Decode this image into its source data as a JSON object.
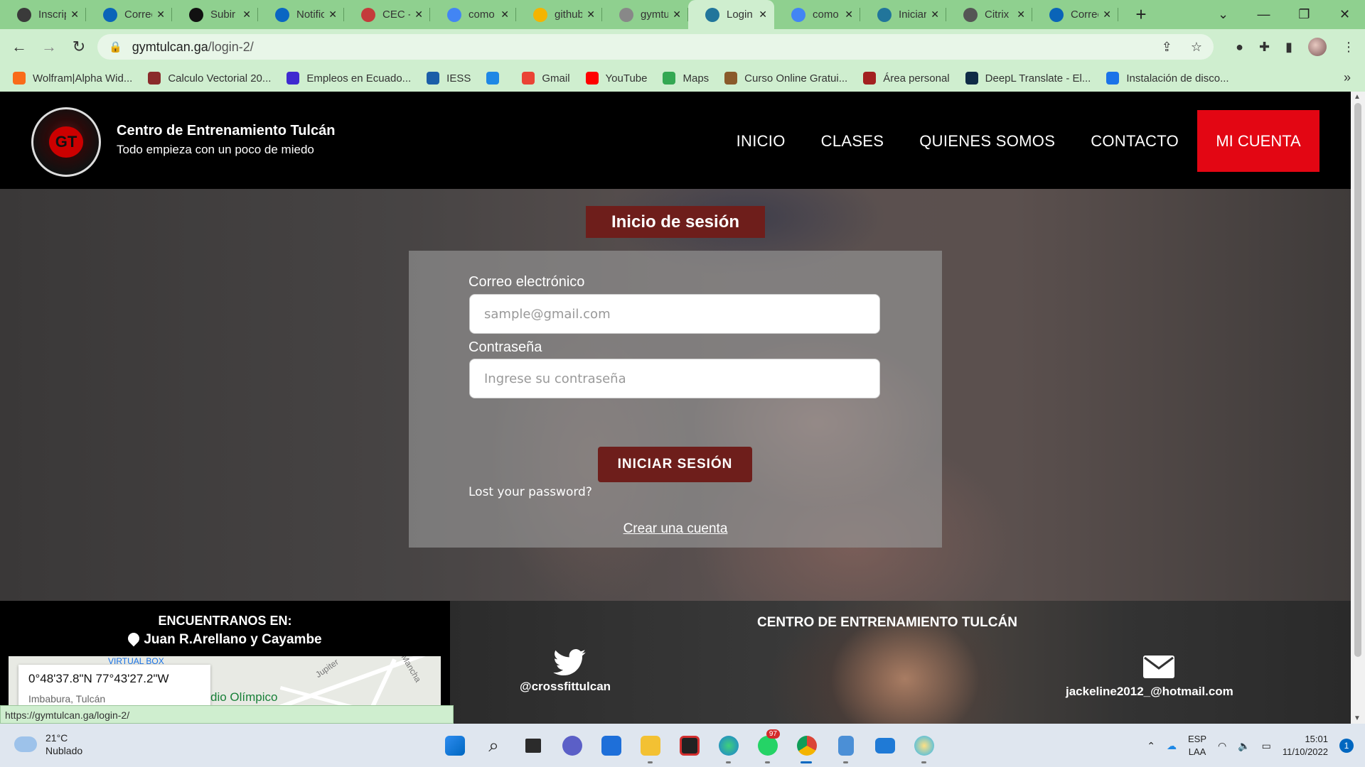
{
  "browser": {
    "tabs": [
      {
        "label": "Inscrip",
        "favicon_color": "#3a3a3a"
      },
      {
        "label": "Correo",
        "favicon_color": "#0a64b8"
      },
      {
        "label": "Subir",
        "favicon_color": "#111111"
      },
      {
        "label": "Notific",
        "favicon_color": "#0a66c2"
      },
      {
        "label": "CEC -",
        "favicon_color": "#c43b3b"
      },
      {
        "label": "como",
        "favicon_color": "#4285f4"
      },
      {
        "label": "github",
        "favicon_color": "#f4b400"
      },
      {
        "label": "gymtu",
        "favicon_color": "#888888"
      },
      {
        "label": "Login",
        "favicon_color": "#21759b",
        "active": true
      },
      {
        "label": "como",
        "favicon_color": "#4285f4"
      },
      {
        "label": "Iniciar",
        "favicon_color": "#21759b"
      },
      {
        "label": "Citrix",
        "favicon_color": "#555555"
      },
      {
        "label": "Correo",
        "favicon_color": "#0a64b8"
      }
    ],
    "url_host": "gymtulcan.ga",
    "url_path": "/login-2/",
    "bookmarks": [
      {
        "label": "Wolfram|Alpha Wid...",
        "icon_color": "#f96b1a"
      },
      {
        "label": "Calculo Vectorial 20...",
        "icon_color": "#8a2b2b"
      },
      {
        "label": "Empleos en Ecuado...",
        "icon_color": "#3f2ad0"
      },
      {
        "label": "IESS",
        "icon_color": "#1b5ea8"
      },
      {
        "label": "",
        "icon_color": "#1e88e5"
      },
      {
        "label": "Gmail",
        "icon_color": "#ea4335"
      },
      {
        "label": "YouTube",
        "icon_color": "#ff0000"
      },
      {
        "label": "Maps",
        "icon_color": "#34a853"
      },
      {
        "label": "Curso Online Gratui...",
        "icon_color": "#8a5a2b"
      },
      {
        "label": "Área personal",
        "icon_color": "#a32020"
      },
      {
        "label": "DeepL Translate - El...",
        "icon_color": "#0f2b46"
      },
      {
        "label": "Instalación de disco...",
        "icon_color": "#1a73e8"
      }
    ],
    "status_url": "https://gymtulcan.ga/login-2/"
  },
  "site": {
    "brand_title": "Centro de Entrenamiento Tulcán",
    "brand_subtitle": "Todo empieza con un poco de miedo",
    "logo_text": "GT",
    "nav": [
      "INICIO",
      "CLASES",
      "QUIENES SOMOS",
      "CONTACTO"
    ],
    "cta": "MI CUENTA",
    "accent_color": "#e30613"
  },
  "login": {
    "title": "Inicio de sesión",
    "email_label": "Correo electrónico",
    "email_placeholder": "sample@gmail.com",
    "password_label": "Contraseña",
    "password_placeholder": "Ingrese su contraseña",
    "submit": "INICIAR SESIÓN",
    "lost_password": "Lost your password?",
    "create_account": "Crear una cuenta",
    "button_color": "#6e1e1b"
  },
  "footer": {
    "find_title": "ENCUENTRANOS EN:",
    "address": "Juan R.Arellano y Cayambe",
    "map_coords": "0°48'37.8\"N 77°43'27.2\"W",
    "map_region": "Imbabura, Tulcán",
    "map_place": "dio Olímpico",
    "map_road_1": "Jupiter",
    "map_road_2": "Mancha",
    "map_poi": "VIRTUAL BOX",
    "center_title": "CENTRO DE ENTRENAMIENTO TULCÁN",
    "twitter_handle": "@crossfittulcan",
    "email": "jackeline2012_@hotmail.com"
  },
  "taskbar": {
    "temperature": "21°C",
    "weather": "Nublado",
    "whatsapp_badge": "97",
    "lang_1": "ESP",
    "lang_2": "LAA",
    "time": "15:01",
    "date": "11/10/2022",
    "notifications": "1"
  }
}
